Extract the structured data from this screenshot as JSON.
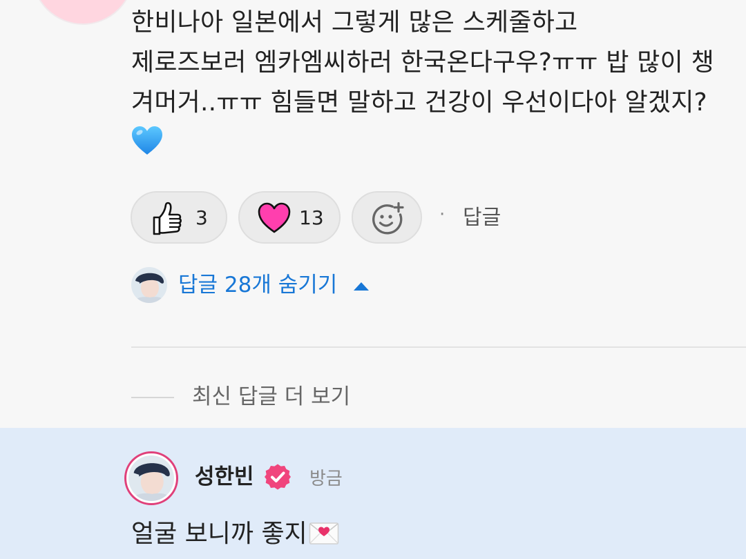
{
  "comment": {
    "lines": [
      "한비나아 일본에서 그렇게 많은 스케줄하고",
      "제로즈보러 엠카엠씨하러 한국온다구우?ㅠㅠ 밥 많이 챙",
      "겨머거..ㅠㅠ 힘들면 말하고 건강이 우선이다아 알겠지?"
    ],
    "emoji": "blue-heart"
  },
  "reactions": {
    "like": {
      "icon": "thumbs-up-icon",
      "count": "3"
    },
    "love": {
      "icon": "heart-icon",
      "count": "13"
    },
    "add": {
      "icon": "add-reaction-icon"
    },
    "separator": "·",
    "reply_label": "답글"
  },
  "replies_toggle": {
    "label": "답글 28개 숨기기",
    "icon": "caret-up-icon"
  },
  "more_replies": {
    "label": "최신 답글 더 보기"
  },
  "reply": {
    "author": "성한빈",
    "verified": true,
    "timestamp": "방금",
    "text": "얼굴 보니까 좋지",
    "emoji": "envelope-with-heart"
  },
  "colors": {
    "background": "#f7f7f7",
    "highlight": "#e0ebf9",
    "link_blue": "#1877d6",
    "heart_pink": "#ff3fae",
    "badge_pink": "#f0457d",
    "avatar_ring": "#e0407a"
  }
}
